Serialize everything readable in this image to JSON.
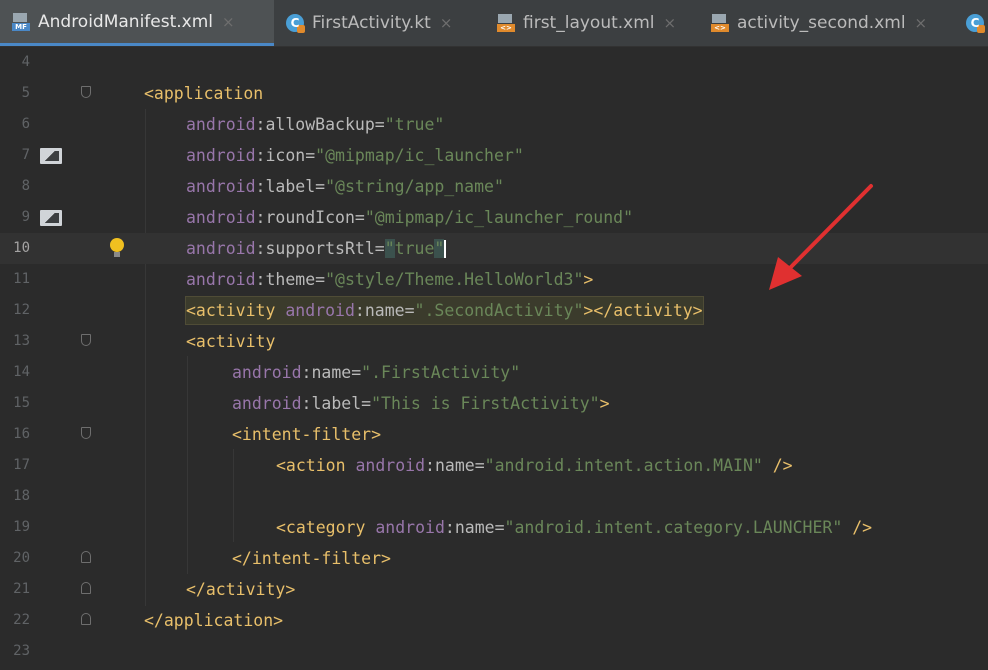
{
  "tabs": [
    {
      "label": "AndroidManifest.xml",
      "icon": "manifest-file-icon",
      "active": true
    },
    {
      "label": "FirstActivity.kt",
      "icon": "kotlin-class-icon"
    },
    {
      "label": "first_layout.xml",
      "icon": "xml-file-icon"
    },
    {
      "label": "activity_second.xml",
      "icon": "xml-file-icon"
    }
  ],
  "close_glyph": "×",
  "editor": {
    "current_line": "10",
    "lines": [
      {
        "num": "4"
      },
      {
        "num": "5"
      },
      {
        "num": "6"
      },
      {
        "num": "7"
      },
      {
        "num": "8"
      },
      {
        "num": "9"
      },
      {
        "num": "10"
      },
      {
        "num": "11"
      },
      {
        "num": "12"
      },
      {
        "num": "13"
      },
      {
        "num": "14"
      },
      {
        "num": "15"
      },
      {
        "num": "16"
      },
      {
        "num": "17"
      },
      {
        "num": "18"
      },
      {
        "num": "19"
      },
      {
        "num": "20"
      },
      {
        "num": "21"
      },
      {
        "num": "22"
      },
      {
        "num": "23"
      }
    ],
    "tokens": {
      "app_open": "<application",
      "android": "android",
      "colon": ":",
      "eq": "=",
      "q": "\"",
      "allowBackup": "allowBackup",
      "true": "true",
      "icon": "icon",
      "icon_val": "@mipmap/ic_launcher",
      "label": "label",
      "label_val": "@string/app_name",
      "roundIcon": "roundIcon",
      "roundIcon_val": "@mipmap/ic_launcher_round",
      "supportsRtl": "supportsRtl",
      "theme": "theme",
      "theme_val": "@style/Theme.HelloWorld3",
      "close_gt": ">",
      "activity_open": "<activity",
      "name": "name",
      "second_val": ".SecondActivity",
      "activity_close": "</activity>",
      "first_val": ".FirstActivity",
      "first_label_val": "This is FirstActivity",
      "intent_open": "<intent-filter>",
      "action_open": "<action",
      "action_val": "android.intent.action.MAIN",
      "self_close": " />",
      "category_open": "<category",
      "category_val": "android.intent.category.LAUNCHER",
      "intent_close": "</intent-filter>",
      "app_close": "</application>"
    }
  },
  "annotation": {
    "color": "#e03030"
  },
  "colors": {
    "tag": "#e8bf6a",
    "namespace": "#9876aa",
    "value": "#6a8759",
    "background": "#2b2b2b"
  }
}
